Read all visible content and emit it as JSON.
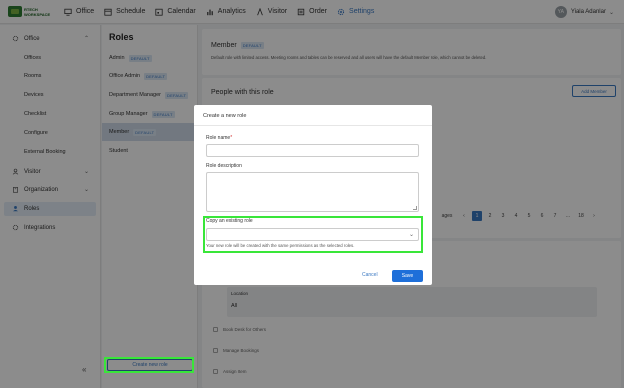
{
  "topnav": {
    "logo_line1": "RTECH",
    "logo_line2": "WORKSPACE",
    "items": [
      {
        "label": "Office",
        "icon": "monitor-icon"
      },
      {
        "label": "Schedule",
        "icon": "calendar-grid-icon"
      },
      {
        "label": "Calendar",
        "icon": "calendar-icon"
      },
      {
        "label": "Analytics",
        "icon": "analytics-icon"
      },
      {
        "label": "Visitor",
        "icon": "visitor-icon"
      },
      {
        "label": "Order",
        "icon": "order-icon"
      },
      {
        "label": "Settings",
        "icon": "gear-icon"
      }
    ],
    "active": "Settings",
    "user_initials": "YA",
    "user_name": "Yiala Adanlar"
  },
  "sidebar": {
    "office": "Office",
    "office_items": [
      "Offices",
      "Rooms",
      "Devices",
      "Checklist",
      "Configure",
      "External Booking"
    ],
    "visitor": "Visitor",
    "organization": "Organization",
    "roles": "Roles",
    "integrations": "Integrations",
    "collapse": "«"
  },
  "roles_panel": {
    "title": "Roles",
    "default_badge": "DEFAULT",
    "items": [
      {
        "name": "Admin",
        "default": true
      },
      {
        "name": "Office Admin",
        "default": true
      },
      {
        "name": "Department Manager",
        "default": true
      },
      {
        "name": "Group Manager",
        "default": true
      },
      {
        "name": "Member",
        "default": true,
        "selected": true
      },
      {
        "name": "Student",
        "default": false
      }
    ],
    "create_button": "Create new role"
  },
  "main": {
    "member_title": "Member",
    "member_badge": "DEFAULT",
    "member_desc": "Default role with limited access. Meeting rooms and tables can be reserved and all users will have the default Member role, which cannot be deleted.",
    "people_title": "People with this role",
    "add_member": "Add Member",
    "pages_label": "ages",
    "pages": [
      "1",
      "2",
      "3",
      "4",
      "5",
      "6",
      "7",
      "...",
      "18"
    ],
    "current_page": "1",
    "location_label": "Location",
    "location_value": "All",
    "permissions": [
      "Book Desk for Others",
      "Manage Bookings",
      "Assign Item"
    ]
  },
  "modal": {
    "title": "Create a new role",
    "role_name_label": "Role name",
    "required_mark": "*",
    "role_desc_label": "Role description",
    "copy_label": "Copy an existing role",
    "copy_hint": "Your new role will be created with the same permissions as the selected roles.",
    "cancel": "Cancel",
    "save": "Save"
  },
  "colors": {
    "accent": "#3a78c2",
    "save": "#1e6fd9",
    "highlight": "#39e639"
  }
}
